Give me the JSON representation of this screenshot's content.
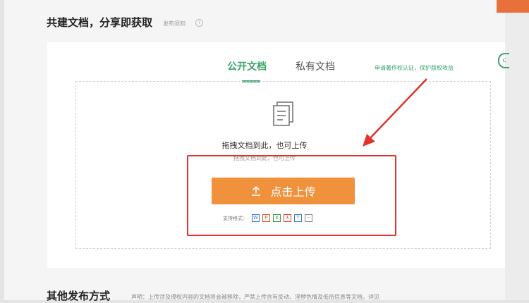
{
  "header": {
    "title": "共建文档，分享即获取",
    "note": "发布须知",
    "info_icon": "i"
  },
  "tabs": [
    {
      "label": "公开文档",
      "active": true
    },
    {
      "label": "私有文档",
      "active": false
    }
  ],
  "cert_link": "申请著作权认证，保护版权收益",
  "side_icon": "c",
  "upload": {
    "drag_text": "拖拽文档到此，也可上传",
    "drag_subtext": "拖拽文档到此，也可上传",
    "button_label": "点击上传",
    "formats_label": "支持格式：",
    "formats": [
      {
        "icon": "word-icon",
        "letter": "W",
        "color": "#3b7bd6"
      },
      {
        "icon": "ppt-icon",
        "letter": "P",
        "color": "#e0582c"
      },
      {
        "icon": "excel-icon",
        "letter": "X",
        "color": "#2f9a52"
      },
      {
        "icon": "pdf-icon",
        "letter": "⅄",
        "color": "#d93a2f"
      },
      {
        "icon": "txt-icon",
        "letter": "T",
        "color": "#3b7bd6"
      },
      {
        "icon": "more-icon",
        "letter": "···",
        "color": "#888888"
      }
    ]
  },
  "other": {
    "title": "其他发布方式",
    "disclaimer": "声明：上传涉及侵权内容的文档将会被移除，严禁上传含有反动、淫秽色情及低俗信息等文档，详见"
  },
  "colors": {
    "accent_green": "#3aa56a",
    "upload_orange": "#f0913c",
    "annotation_red": "#e0342c"
  }
}
